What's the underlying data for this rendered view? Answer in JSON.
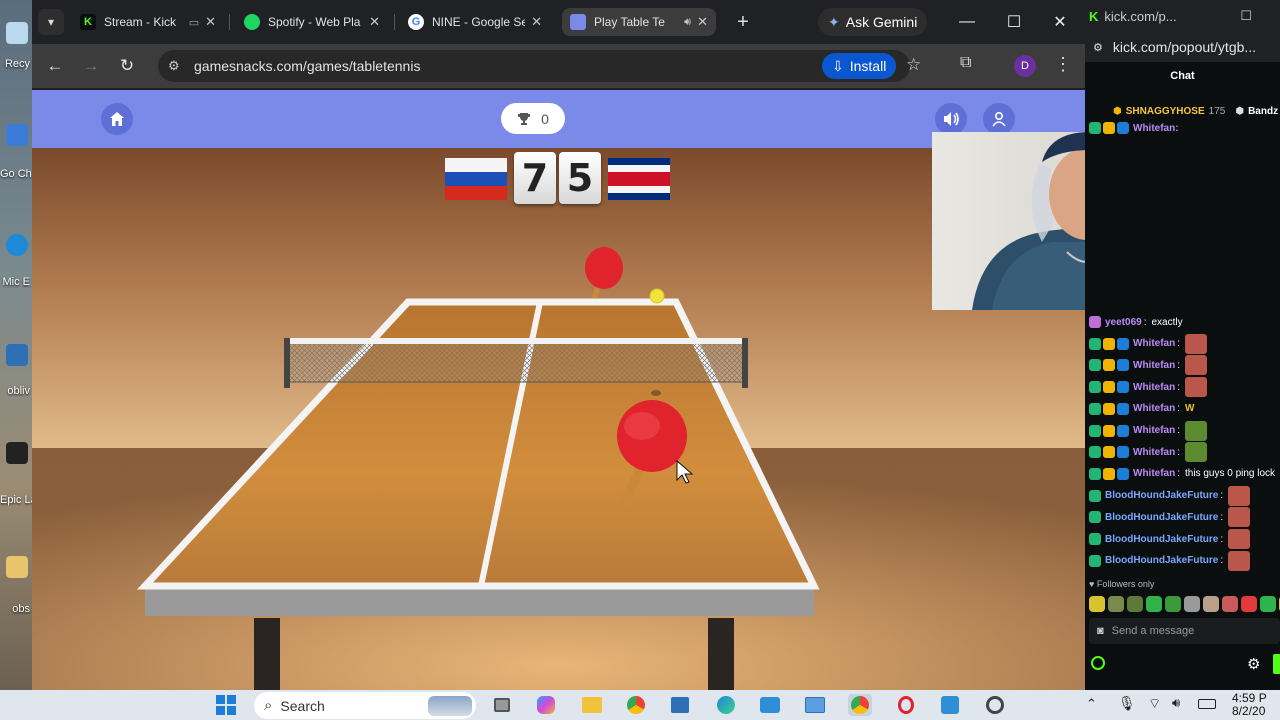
{
  "desktop": {
    "icons": [
      {
        "label": "Recy",
        "icon": "recycle-bin-icon",
        "color": "#9cc8e8"
      },
      {
        "label": "Go Ch",
        "icon": "chrome-shortcut-icon",
        "color": "#3b7cd9"
      },
      {
        "label": "Mic E",
        "icon": "edge-shortcut-icon",
        "color": "#1c8ad6"
      },
      {
        "label": "obliv",
        "icon": "app-shortcut-icon",
        "color": "#2f6fb6"
      },
      {
        "label": "Epic Lau",
        "icon": "epic-games-icon",
        "color": "#222222"
      },
      {
        "label": "obs",
        "icon": "obs-icon",
        "color": "#e8c46a"
      }
    ]
  },
  "browser": {
    "tabs": [
      {
        "title": "Stream - Kick",
        "icon": "kick-icon",
        "color": "#53fc18"
      },
      {
        "title": "Spotify - Web Pla",
        "icon": "spotify-icon",
        "color": "#1ed760"
      },
      {
        "title": "NINE - Google Se",
        "icon": "google-icon",
        "color": "#4285f4"
      },
      {
        "title": "Play Table Te",
        "icon": "gamesnacks-icon",
        "color": "#7b8ae8"
      }
    ],
    "gemini_label": "Ask Gemini",
    "url": "gamesnacks.com/games/tabletennis",
    "install_label": "Install",
    "profile_initial": "D"
  },
  "game": {
    "trophy_score": "0",
    "scoreboard": {
      "left_score": "7",
      "right_score": "5",
      "left_flag": "russia-flag",
      "right_flag": "costa-rica-flag"
    },
    "colors": {
      "header": "#7b8ae8",
      "paddle": "#e0232c",
      "ball": "#f2e23a",
      "table": "#c9832f"
    }
  },
  "chat_window": {
    "title": "kick.com/p...",
    "url": "kick.com/popout/ytgb...",
    "heading": "Chat",
    "pinned": [
      {
        "name": "SHNAGGYHOSE",
        "count": "175"
      },
      {
        "name": "Bandz",
        "count": ""
      }
    ],
    "top_partial_user": "Whitefan:",
    "messages": [
      {
        "user": "yeet069",
        "text": "exactly",
        "color": "#b98cf5",
        "emote": ""
      },
      {
        "user": "Whitefan",
        "text": "",
        "color": "#b98cf5",
        "emote": "face"
      },
      {
        "user": "Whitefan",
        "text": "",
        "color": "#b98cf5",
        "emote": "face"
      },
      {
        "user": "Whitefan",
        "text": "",
        "color": "#b98cf5",
        "emote": "face"
      },
      {
        "user": "Whitefan",
        "text": "W",
        "color": "#b98cf5",
        "emote": ""
      },
      {
        "user": "Whitefan",
        "text": "",
        "color": "#b98cf5",
        "emote": "frog"
      },
      {
        "user": "Whitefan",
        "text": "",
        "color": "#b98cf5",
        "emote": "frog"
      },
      {
        "user": "Whitefan",
        "text": "this guys 0 ping lock",
        "color": "#b98cf5",
        "emote": ""
      },
      {
        "user": "BloodHoundJakeFuture",
        "text": "",
        "color": "#7aa7ff",
        "emote": "face"
      },
      {
        "user": "BloodHoundJakeFuture",
        "text": "",
        "color": "#7aa7ff",
        "emote": "face"
      },
      {
        "user": "BloodHoundJakeFuture",
        "text": "",
        "color": "#7aa7ff",
        "emote": "face"
      },
      {
        "user": "BloodHoundJakeFuture",
        "text": "",
        "color": "#7aa7ff",
        "emote": "face"
      }
    ],
    "followers_only": "Followers only",
    "send_placeholder": "Send a message"
  },
  "taskbar": {
    "search_label": "Search",
    "time": "4:59 P",
    "date": "8/2/20"
  }
}
